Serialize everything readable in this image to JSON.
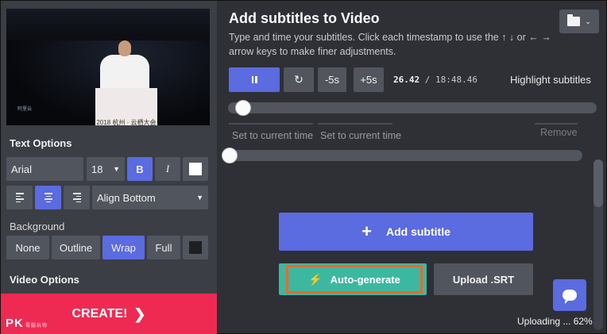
{
  "video": {
    "podium_caption": "2018 杭州 · 云栖大会",
    "logo_caption": "阿里云"
  },
  "text_options": {
    "title": "Text Options",
    "font": "Arial",
    "size": "18",
    "bold": "B",
    "italic": "I",
    "align_position": "Align Bottom",
    "text_color": "#ffffff"
  },
  "background": {
    "label": "Background",
    "options": [
      "None",
      "Outline",
      "Wrap",
      "Full"
    ],
    "selected": "Wrap",
    "color": "#1e1f22"
  },
  "video_options": {
    "title": "Video Options"
  },
  "create": {
    "label": "CREATE!"
  },
  "watermark": {
    "text": "PK",
    "sub": "電腦玩物"
  },
  "header": {
    "title": "Add subtitles to Video",
    "description": "Type and time your subtitles. Click each timestamp to use the ↑ ↓ or ← → arrow keys to make finer adjustments."
  },
  "player": {
    "rewind": "-5s",
    "forward": "+5s",
    "current_time": "26.42",
    "separator": " / ",
    "duration": "18:48.46",
    "highlight_label": "Highlight subtitles",
    "progress": 0.02
  },
  "subtitle_row": {
    "set_start": "Set to current time",
    "set_end": "Set to current time",
    "remove": "Remove"
  },
  "actions": {
    "add_subtitle": "Add subtitle",
    "auto_generate": "Auto-generate",
    "upload_srt": "Upload .SRT"
  },
  "status": {
    "uploading": "Uploading ... 62%"
  },
  "colors": {
    "accent": "#5b6be0",
    "create": "#ef2a52",
    "auto": "#3cb8a1",
    "highlight_border": "#f2672a"
  }
}
